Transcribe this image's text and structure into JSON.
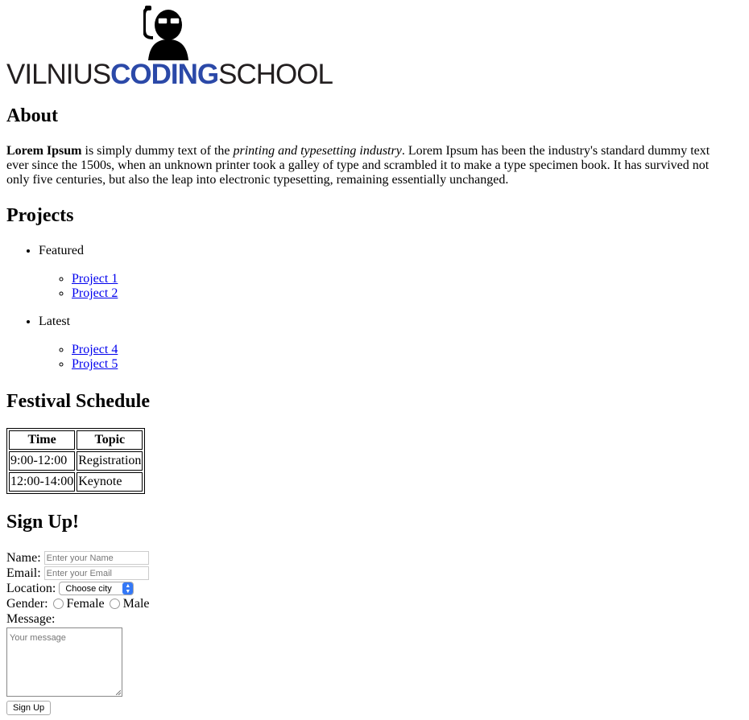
{
  "logo": {
    "word1": "VILNIUS",
    "word2": "CODING",
    "word3": "SCHOOL",
    "icon": "ninja-icon",
    "accent": "#2b49a8"
  },
  "about": {
    "heading": "About",
    "bold": "Lorem Ipsum",
    "text1": " is simply dummy text of the ",
    "italic": "printing and typesetting industry",
    "text2": ". Lorem Ipsum has been the industry's standard dummy text ever since the 1500s, when an unknown printer took a galley of type and scrambled it to make a type specimen book. It has survived not only five centuries, but also the leap into electronic typesetting, remaining essentially unchanged."
  },
  "projects": {
    "heading": "Projects",
    "groups": [
      {
        "label": "Featured",
        "items": [
          "Project 1",
          "Project 2"
        ]
      },
      {
        "label": "Latest",
        "items": [
          "Project 4",
          "Project 5"
        ]
      }
    ]
  },
  "schedule": {
    "heading": "Festival Schedule",
    "columns": [
      "Time",
      "Topic"
    ],
    "rows": [
      [
        "9:00-12:00",
        "Registration"
      ],
      [
        "12:00-14:00",
        "Keynote"
      ]
    ]
  },
  "signup": {
    "heading": "Sign Up!",
    "name_label": "Name:",
    "name_placeholder": "Enter your Name",
    "email_label": "Email:",
    "email_placeholder": "Enter your Email",
    "location_label": "Location:",
    "location_selected": "Choose city",
    "gender_label": "Gender:",
    "gender_female": "Female",
    "gender_male": "Male",
    "message_label": "Message:",
    "message_placeholder": "Your message",
    "submit_label": "Sign Up"
  }
}
